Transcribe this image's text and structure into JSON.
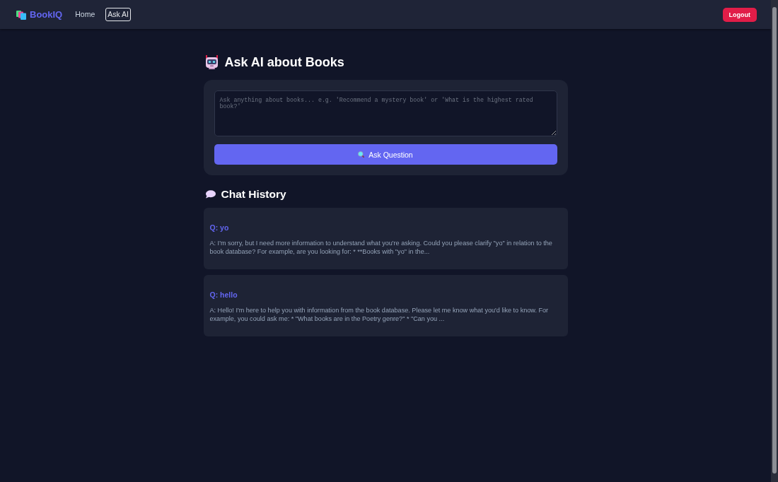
{
  "navbar": {
    "brand": "BookIQ",
    "links": [
      {
        "label": "Home",
        "selected": false
      },
      {
        "label": "Ask AI",
        "selected": true
      }
    ],
    "logout_button": "Logout"
  },
  "ask_section": {
    "title": "Ask AI about Books",
    "question_field": {
      "placeholder": "Ask anything about books... e.g. 'Recommend a mystery book' or 'What is the highest rated book?'"
    },
    "submit_button": "Ask Question"
  },
  "chat_history": {
    "title": "Chat History",
    "entries": [
      {
        "question": "Q: yo",
        "answer": "A: I'm sorry, but I need more information to understand what you're asking. Could you please clarify \"yo\" in relation to the book database? For example, are you looking for: * **Books with \"yo\" in the..."
      },
      {
        "question": "Q: hello",
        "answer": "A: Hello! I'm here to help you with information from the book database. Please let me know what you'd like to know. For example, you could ask me: * \"What books are in the Poetry genre?\" * \"Can you ..."
      }
    ]
  }
}
